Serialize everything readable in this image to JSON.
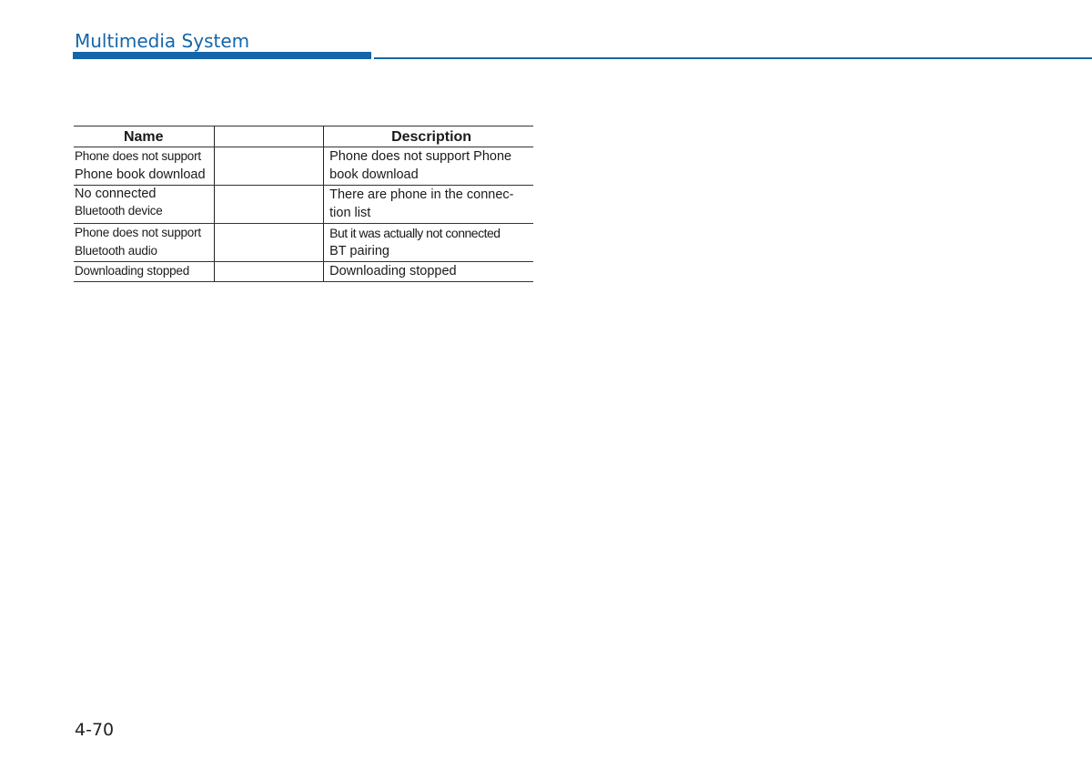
{
  "header": {
    "title": "Multimedia System",
    "accent_color": "#1565a8"
  },
  "table": {
    "columns": [
      "Name",
      "",
      "Description"
    ],
    "rows": [
      {
        "name_lines": [
          "Phone does not support",
          "Phone book download"
        ],
        "middle": "",
        "description_lines": [
          "Phone does not support Phone",
          "book download"
        ]
      },
      {
        "name_lines": [
          "No connected",
          "Bluetooth device"
        ],
        "middle": "",
        "description_lines": [
          "There are phone in the connec-",
          "tion list"
        ]
      },
      {
        "name_lines": [
          "Phone does not support",
          "Bluetooth audio"
        ],
        "middle": "",
        "description_lines": [
          "But it was actually not connected",
          "BT pairing"
        ]
      },
      {
        "name_lines": [
          "Downloading stopped"
        ],
        "middle": "",
        "description_lines": [
          "Downloading stopped"
        ]
      }
    ]
  },
  "footer": {
    "page_number": "4-70"
  }
}
